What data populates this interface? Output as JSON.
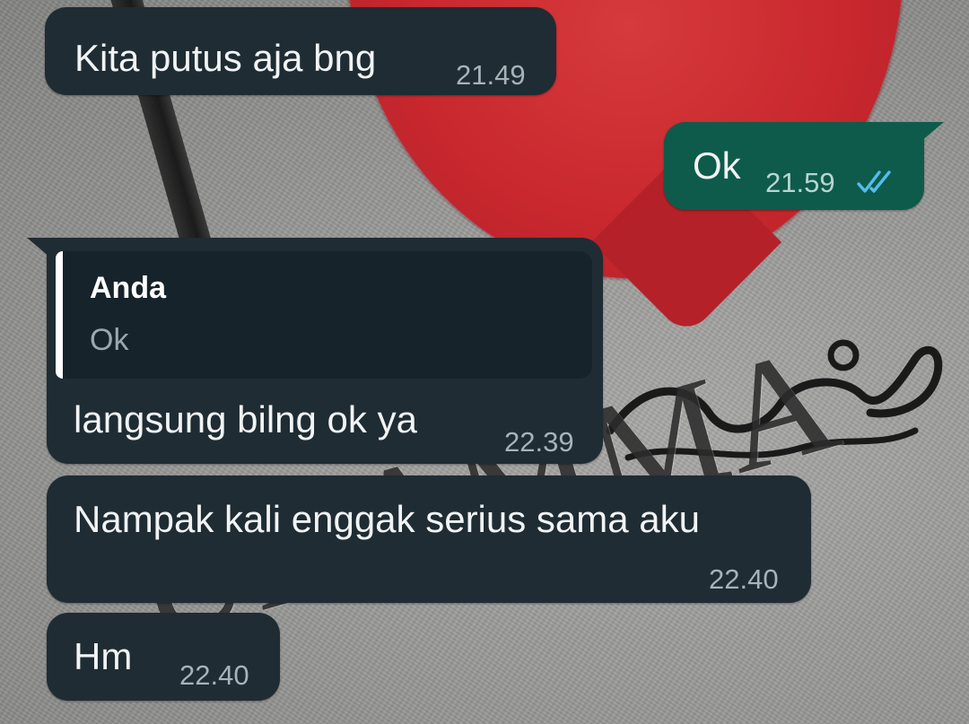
{
  "wallpaper": {
    "engraved_text": "UHAMMA",
    "colors": {
      "heart": "#c8282e",
      "paper": "#979795",
      "ink": "#1a1a1a"
    }
  },
  "colors": {
    "incoming_bubble": "#1f2c33",
    "outgoing_bubble": "#0e5b4c",
    "read_ticks": "#53bdeb"
  },
  "messages": [
    {
      "direction": "incoming",
      "text": "Kita putus aja bng",
      "time": "21.49"
    },
    {
      "direction": "outgoing",
      "text": "Ok",
      "time": "21.59",
      "status": "read",
      "status_icon": "double-check-icon"
    },
    {
      "direction": "incoming",
      "reply_to": {
        "author": "Anda",
        "text": "Ok"
      },
      "text": "langsung bilng ok ya",
      "time": "22.39"
    },
    {
      "direction": "incoming",
      "text": "Nampak kali enggak serius sama aku",
      "time": "22.40"
    },
    {
      "direction": "incoming",
      "text": "Hm",
      "time": "22.40"
    }
  ]
}
